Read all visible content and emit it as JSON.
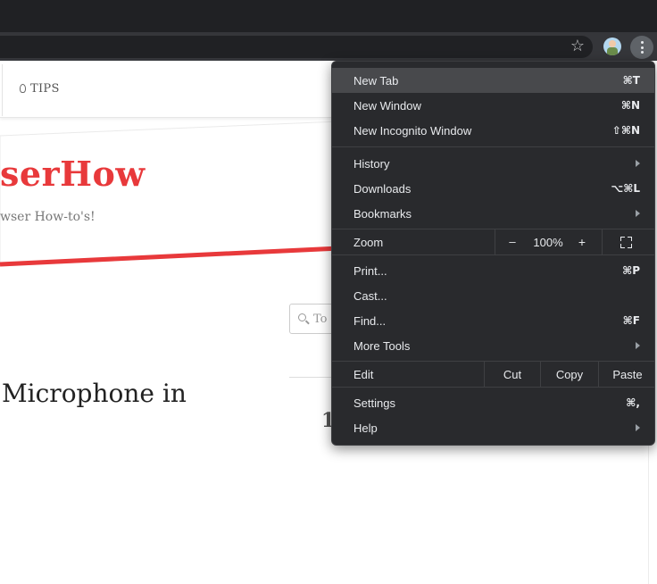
{
  "toolbar": {
    "bookmark_icon": "star-icon",
    "profile_icon": "avatar",
    "menu_icon": "vertical-dots-icon"
  },
  "page": {
    "nav": {
      "tips_label": "TIPS",
      "tips_icon": "lightbulb-icon"
    },
    "site_title": "serHow",
    "site_subtitle": "wser How-to's!",
    "search_placeholder": "To",
    "post_title": "Microphone in",
    "side_number": "1"
  },
  "menu": {
    "new_tab": {
      "label": "New Tab",
      "shortcut": "⌘T"
    },
    "new_window": {
      "label": "New Window",
      "shortcut": "⌘N"
    },
    "new_incognito": {
      "label": "New Incognito Window",
      "shortcut": "⇧⌘N"
    },
    "history": {
      "label": "History"
    },
    "downloads": {
      "label": "Downloads",
      "shortcut": "⌥⌘L"
    },
    "bookmarks": {
      "label": "Bookmarks"
    },
    "zoom": {
      "label": "Zoom",
      "minus": "–",
      "level": "100%",
      "plus": "+"
    },
    "print": {
      "label": "Print...",
      "shortcut": "⌘P"
    },
    "cast": {
      "label": "Cast..."
    },
    "find": {
      "label": "Find...",
      "shortcut": "⌘F"
    },
    "more_tools": {
      "label": "More Tools"
    },
    "edit": {
      "label": "Edit",
      "cut": "Cut",
      "copy": "Copy",
      "paste": "Paste"
    },
    "settings": {
      "label": "Settings",
      "shortcut": "⌘,"
    },
    "help": {
      "label": "Help"
    }
  },
  "colors": {
    "menu_bg": "#292a2d",
    "menu_highlight": "#48494c",
    "brand_red": "#e8393b",
    "tabstrip": "#202124",
    "toolbar": "#35363a"
  }
}
